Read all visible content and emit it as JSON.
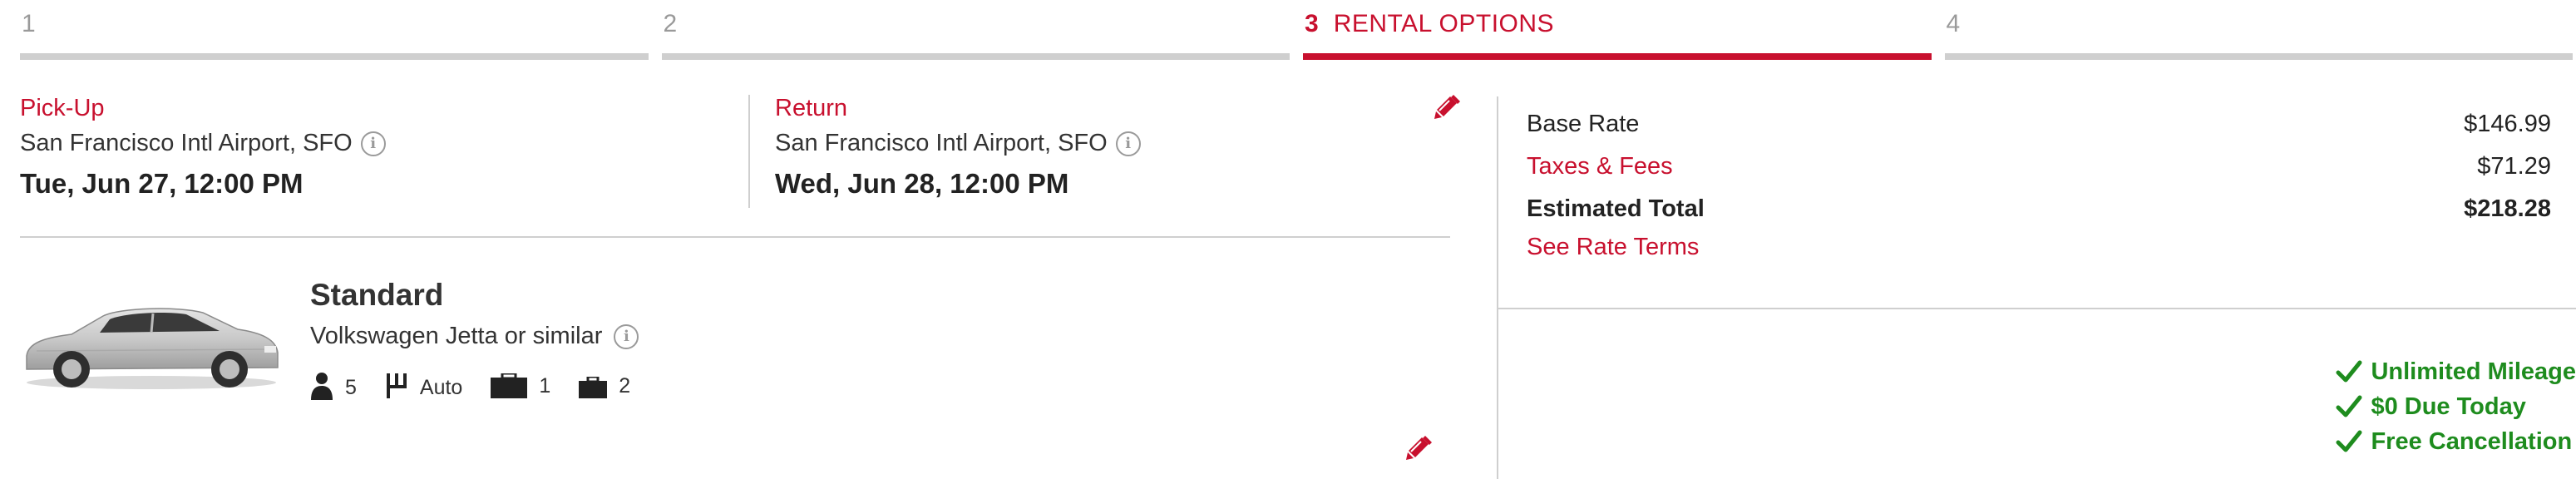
{
  "stepper": {
    "steps": [
      {
        "number": "1",
        "label": ""
      },
      {
        "number": "2",
        "label": ""
      },
      {
        "number": "3",
        "label": "RENTAL OPTIONS"
      },
      {
        "number": "4",
        "label": ""
      }
    ],
    "active_index": 2
  },
  "pickup": {
    "title": "Pick-Up",
    "location": "San Francisco Intl Airport, SFO",
    "datetime": "Tue, Jun 27, 12:00 PM"
  },
  "return": {
    "title": "Return",
    "location": "San Francisco Intl Airport, SFO",
    "datetime": "Wed, Jun 28, 12:00 PM"
  },
  "vehicle": {
    "class": "Standard",
    "model": "Volkswagen Jetta or similar",
    "passengers": "5",
    "transmission": "Auto",
    "large_bags": "1",
    "small_bags": "2"
  },
  "pricing": {
    "base_rate_label": "Base Rate",
    "base_rate": "$146.99",
    "taxes_label": "Taxes & Fees",
    "taxes": "$71.29",
    "total_label": "Estimated Total",
    "total": "$218.28",
    "rate_terms_link": "See Rate Terms"
  },
  "benefits": [
    "Unlimited Mileage",
    "$0 Due Today",
    "Free Cancellation"
  ],
  "colors": {
    "accent": "#c8102e",
    "success": "#1e8c1e",
    "inactive_bar": "#cfcfcf"
  },
  "icons": [
    "info-icon",
    "pencil-icon",
    "person-icon",
    "gear-shift-icon",
    "suitcase-icon",
    "briefcase-icon",
    "check-icon"
  ]
}
